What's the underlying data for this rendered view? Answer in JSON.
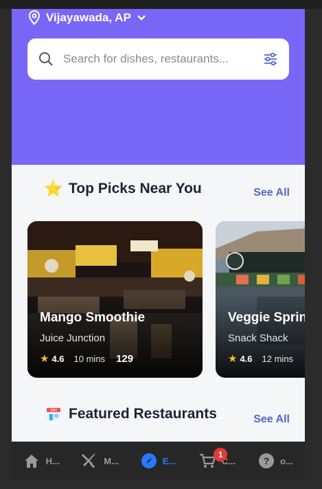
{
  "header": {
    "location": "Vijayawada, AP",
    "location_icon": "map-pin-icon",
    "dropdown_icon": "chevron-down-icon"
  },
  "search": {
    "placeholder": "Search for dishes, restaurants...",
    "value": "",
    "search_icon": "search-icon",
    "filter_icon": "filter-sliders-icon"
  },
  "top_picks": {
    "emoji": "⭐",
    "title": "Top Picks Near You",
    "see_all": "See All",
    "items": [
      {
        "title": "Mango Smoothie",
        "restaurant": "Juice Junction",
        "rating": "4.6",
        "time": "10 mins",
        "count": "129"
      },
      {
        "title": "Veggie Spring Rolls",
        "restaurant": "Snack Shack",
        "rating": "4.6",
        "time": "12 mins",
        "count": ""
      }
    ]
  },
  "featured": {
    "emoji": "🏪",
    "title": "Featured Restaurants",
    "see_all": "See All"
  },
  "nav": {
    "items": [
      {
        "label": "H...",
        "icon": "home-icon"
      },
      {
        "label": "M...",
        "icon": "utensils-icon"
      },
      {
        "label": "E...",
        "icon": "compass-icon",
        "active": true
      },
      {
        "label": "C...",
        "icon": "cart-icon",
        "badge": "1"
      },
      {
        "label": "o...",
        "icon": "help-icon"
      }
    ]
  },
  "colors": {
    "hero": "#7866f6",
    "accent": "#5565c7",
    "active_nav": "#2979ff",
    "badge": "#e53935"
  }
}
